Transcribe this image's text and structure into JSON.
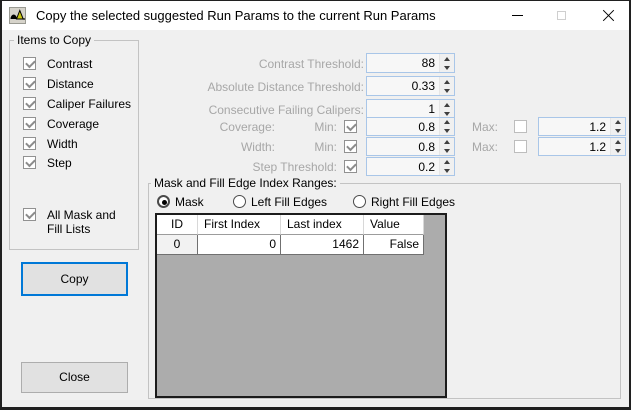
{
  "window": {
    "title": "Copy the selected suggested Run Params to the current Run Params"
  },
  "items_to_copy": {
    "title": "Items to Copy",
    "items": [
      {
        "label": "Contrast",
        "checked": true
      },
      {
        "label": "Distance",
        "checked": true
      },
      {
        "label": "Caliper Failures",
        "checked": true
      },
      {
        "label": "Coverage",
        "checked": true
      },
      {
        "label": "Width",
        "checked": true
      },
      {
        "label": "Step",
        "checked": true
      },
      {
        "label": "All Mask and Fill Lists",
        "checked": true
      }
    ]
  },
  "actions": {
    "copy": "Copy",
    "close": "Close"
  },
  "params": {
    "contrast_threshold": {
      "label": "Contrast Threshold:",
      "value": "88"
    },
    "absolute_distance_threshold": {
      "label": "Absolute Distance Threshold:",
      "value": "0.33"
    },
    "consecutive_failing_calipers": {
      "label": "Consecutive Failing Calipers:",
      "value": "1"
    },
    "coverage": {
      "label": "Coverage:",
      "min_label": "Min:",
      "min_checked": true,
      "min_value": "0.8",
      "max_label": "Max:",
      "max_checked": false,
      "max_value": "1.2"
    },
    "width": {
      "label": "Width:",
      "min_label": "Min:",
      "min_checked": true,
      "min_value": "0.8",
      "max_label": "Max:",
      "max_checked": false,
      "max_value": "1.2"
    },
    "step_threshold": {
      "label": "Step Threshold:",
      "checked": true,
      "value": "0.2"
    }
  },
  "mask_section": {
    "title": "Mask and Fill Edge Index Ranges:",
    "radios": [
      {
        "label": "Mask",
        "selected": true
      },
      {
        "label": "Left Fill Edges",
        "selected": false
      },
      {
        "label": "Right Fill Edges",
        "selected": false
      }
    ],
    "table": {
      "columns": [
        "ID",
        "First Index",
        "Last index",
        "Value"
      ],
      "rows": [
        {
          "id": "0",
          "first_index": "0",
          "last_index": "1462",
          "value": "False"
        }
      ]
    }
  },
  "colors": {
    "accent": "#0078D7",
    "spinner_border": "#A9C6E8",
    "grid_background": "#ACACAC",
    "disabled_text": "#A7A7A7"
  }
}
